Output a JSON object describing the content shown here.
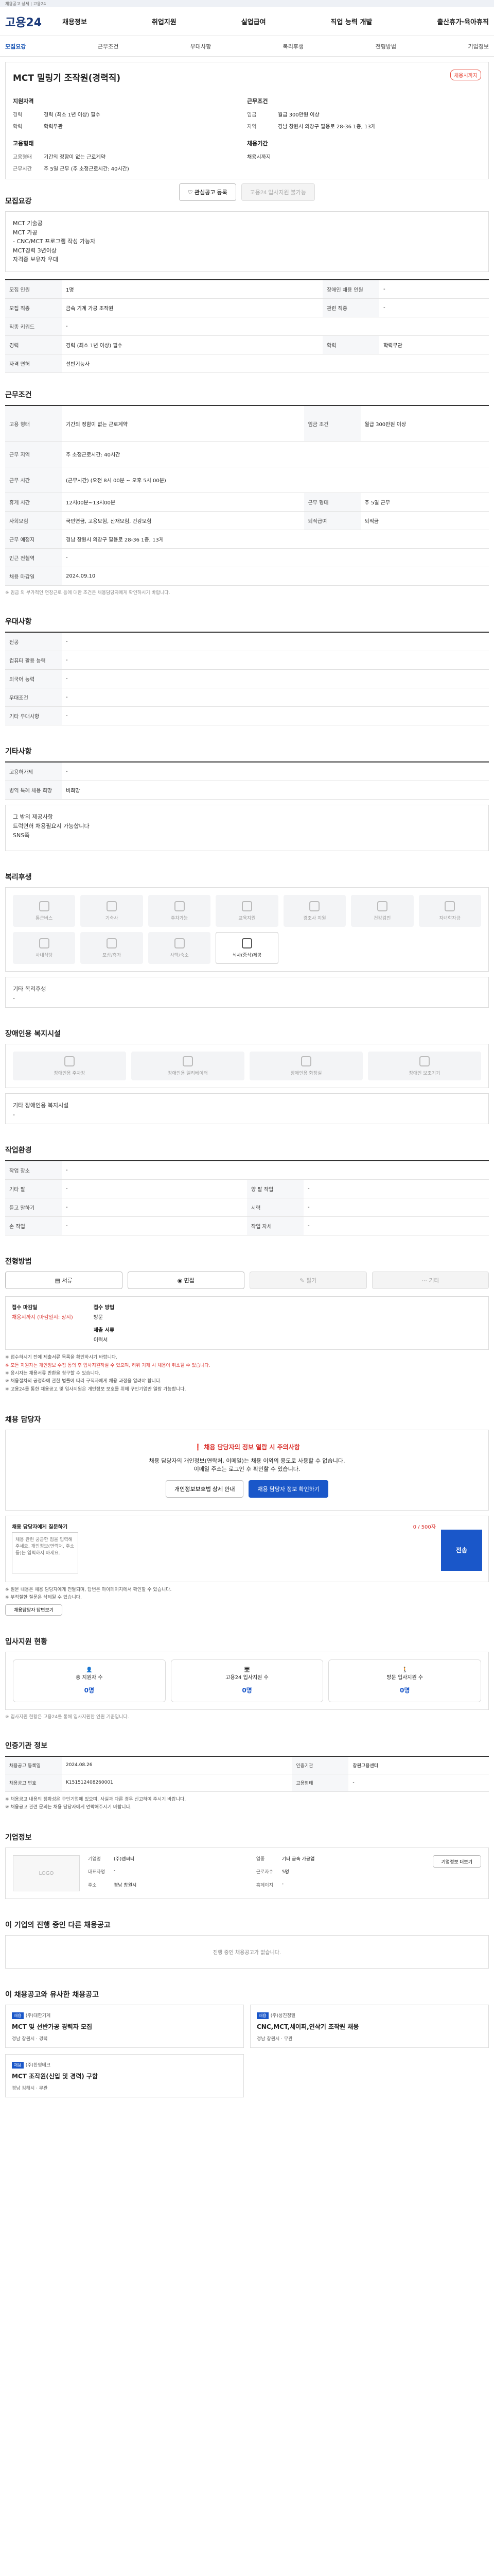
{
  "topbar": "채용공고 상세 | 고용24",
  "gnb": {
    "logo": "고용24",
    "menu": [
      "채용정보",
      "취업지원",
      "실업급여",
      "직업 능력 개발",
      "출산휴가·육아휴직"
    ]
  },
  "tabs": [
    "모집요강",
    "근무조건",
    "우대사항",
    "복리후생",
    "전형방법",
    "기업정보"
  ],
  "header": {
    "title": "MCT 밀링기 조작원(경력직)",
    "dday": "채용시까지",
    "qual_title": "지원자격",
    "cond_title": "근무조건",
    "career_k": "경력",
    "career_v": "경력 (최소 1년 이상) 필수",
    "edu_k": "학력",
    "edu_v": "학력무관",
    "pay_k": "임금",
    "pay_v": "월급 300만원 이상",
    "loc_k": "지역",
    "loc_v": "경남 창원시 의창구 팔용로 28-36 1층, 13게",
    "form_title": "고용형태",
    "form_k": "고용형태",
    "form_v": "기간의 정함이 없는 근로계약",
    "time_k": "근무시간",
    "time_v": "주 5일 근무 (주 소정근로시간: 40시간)",
    "period_title": "채용기간",
    "period_v": "채용시까지",
    "interest_btn": "관심공고 등록",
    "apply_btn": "고용24 입사지원 불가능"
  },
  "recruit": {
    "title": "모집요강",
    "desc_lines": [
      "MCT 기술공",
      "MCT 가공",
      "- CNC/MCT 프로그램 작성 가능자",
      "",
      "MCT경력 3년이상",
      "자격증 보유자 우대"
    ],
    "rows": [
      {
        "k": "모집 인원",
        "v": "1명",
        "k2": "장애인 채용 인원",
        "v2": "-"
      },
      {
        "k": "모집 직종",
        "v": "금속 기계 가공 조작원",
        "k2": "관련 직종",
        "v2": "-"
      },
      {
        "k": "직종 키워드",
        "v": "-",
        "k2": "",
        "v2": ""
      },
      {
        "k": "경력",
        "v": "경력 (최소 1년 이상) 필수",
        "k2": "학력",
        "v2": "학력무관"
      },
      {
        "k": "자격 면허",
        "v": "선반기능사",
        "k2": "",
        "v2": ""
      }
    ]
  },
  "work": {
    "title": "근무조건",
    "rows": [
      {
        "k": "고용 형태",
        "v": "기간의 정함이 없는 근로계약",
        "k2": "임금 조건",
        "v2": "월급 300만원 이상"
      },
      {
        "k": "근무 지역",
        "v": "주 소정근로시간: 40시간",
        "k2": "",
        "v2": ""
      },
      {
        "k": "근무 시간",
        "v": "(근무시간) (오전 8시 00분 ~ 오후 5시 00분)",
        "k2": "",
        "v2": ""
      },
      {
        "k": "휴게 시간",
        "v": "12시00분~13시00분",
        "k2": "근무 형태",
        "v2": "주 5일 근무"
      },
      {
        "k": "사회보험",
        "v": "국민연금, 고용보험, 산재보험, 건강보험",
        "k2": "퇴직급여",
        "v2": "퇴직금"
      },
      {
        "k": "근무 예정지",
        "v": "경남 창원시 의창구 팔용로 28-36 1층, 13게",
        "k2": "",
        "v2": ""
      },
      {
        "k": "인근 전철역",
        "v": "-",
        "k2": "",
        "v2": ""
      },
      {
        "k": "채용 마감일",
        "v": "2024.09.10",
        "k2": "",
        "v2": ""
      }
    ],
    "note": "※ 임금 외 부가적인 연장근로 등에 대한 조건은 채용담당자에게 확인하시기 바랍니다."
  },
  "pref": {
    "title": "우대사항",
    "rows": [
      {
        "k": "전공",
        "v": "-"
      },
      {
        "k": "컴퓨터 활용 능력",
        "v": "-"
      },
      {
        "k": "외국어 능력",
        "v": "-"
      },
      {
        "k": "우대조건",
        "v": "-"
      },
      {
        "k": "기타 우대사항",
        "v": "-"
      }
    ]
  },
  "etc": {
    "title": "기타사항",
    "rows": [
      {
        "k": "고용허가제",
        "v": "-"
      },
      {
        "k": "병역 특례 채용 희망",
        "v": "비희망"
      }
    ],
    "memo_lines": [
      "그 밖의 제공사항",
      "트럭면허 채용필요시 가능합니다",
      "SNS쪽"
    ]
  },
  "welfare": {
    "title": "복리후생",
    "items": [
      "통근버스",
      "기숙사",
      "주차가능",
      "교육지원",
      "경조사 지원",
      "건강검진",
      "자녀학자금",
      "사내식당",
      "포상/휴가",
      "사택/숙소",
      "식사(중식)제공",
      "",
      "",
      ""
    ],
    "extra_title": "기타 복리후생",
    "extra_v": "-"
  },
  "disability": {
    "title": "장애인용 복지시설",
    "items": [
      "장애인용 주차장",
      "장애인용 엘리베이터",
      "장애인용 화장실",
      "장애인 보조기기"
    ],
    "extra_title": "기타 장애인용 복지시설",
    "extra_v": "-"
  },
  "workenv": {
    "title": "작업환경",
    "rows": [
      {
        "k": "작업 장소",
        "v": "-",
        "k2": "",
        "v2": ""
      },
      {
        "k": "기타 팔",
        "v": "-",
        "k2": "양 팔 작업",
        "v2": "-"
      },
      {
        "k": "듣고 말하기",
        "v": "-",
        "k2": "시력",
        "v2": "-"
      },
      {
        "k": "손 작업",
        "v": "-",
        "k2": "작업 자세",
        "v2": "-"
      }
    ]
  },
  "method": {
    "title": "전형방법",
    "buttons": [
      "서류",
      "면접",
      "필기",
      "기타"
    ],
    "apply_label": "접수 마감일",
    "apply_v": "채용시까지 (마감일시: 상시)",
    "apply_label2": "접수 방법",
    "apply_v2": "방문",
    "docs_label": "제출 서류",
    "docs_v": "이력서",
    "bullets": [
      "※ 접수하시기 전에 제출서류 목록을 확인하시기 바랍니다.",
      "※ 모든 지원자는 개인정보 수집 동의 후 입사지원하실 수 있으며, 허위 기재 시 채용이 취소될 수 있습니다.",
      "※ 응시자는 채용서류 반환을 청구할 수 있습니다.",
      "※ 채용절차의 공정화에 관한 법률에 따라 구직자에게 채용 과정을 알려야 합니다.",
      "※ 고용24를 통한 채용공고 및 입사지원은 개인정보 보호를 위해 구인기업만 열람 가능합니다."
    ]
  },
  "manager": {
    "title": "채용 담당자",
    "warn": "채용 담당자의 정보 열람 시 주의사항",
    "desc1": "채용 담당자의 개인정보(연락처, 이메일)는 채용 이외의 용도로 사용할 수 없습니다.",
    "desc2": "이메일 주소는 로그인 후 확인할 수 있습니다.",
    "btn1": "개인정보보호법 상세 안내",
    "btn2": "채용 담당자 정보 확인하기",
    "qa_title": "채용 담당자에게 질문하기",
    "qa_limit": "0 / 500자",
    "qa_placeholder": "채용 관련 궁금한 점을 입력해주세요. 개인정보(연락처, 주소 등)는 입력하지 마세요.",
    "qa_send": "전송",
    "qa_notes": [
      "※ 질문 내용은 채용 담당자에게 전달되며, 답변은 마이페이지에서 확인할 수 있습니다.",
      "※ 부적절한 질문은 삭제될 수 있습니다."
    ],
    "qa_btn": "채용담당자 답변보기"
  },
  "applicants": {
    "title": "입사지원 현황",
    "items": [
      {
        "label": "총 지원자 수",
        "num": "0명"
      },
      {
        "label": "고용24 입사지원 수",
        "num": "0명"
      },
      {
        "label": "방문 입사지원 수",
        "num": "0명"
      }
    ],
    "note": "※ 입사지원 현황은 고용24를 통해 입사지원한 인원 기준입니다."
  },
  "jobinfo": {
    "title": "인증기관 정보",
    "rows": [
      {
        "k": "채용공고 등록일",
        "v": "2024.08.26",
        "k2": "인증기관",
        "v2": "창원고용센터"
      },
      {
        "k": "채용공고 번호",
        "v": "K151512408260001",
        "k2": "고용형태",
        "v2": "-"
      }
    ],
    "bullets": [
      "※ 채용공고 내용의 정확성은 구인기업에 있으며, 사실과 다른 경우 신고하여 주시기 바랍니다.",
      "※ 채용공고 관련 문의는 채용 담당자에게 연락해주시기 바랍니다."
    ]
  },
  "company": {
    "title": "기업정보",
    "logo": "LOGO",
    "fields": [
      {
        "k": "기업명",
        "v": "(주)엠씨티"
      },
      {
        "k": "업종",
        "v": "기타 금속 가공업"
      },
      {
        "k": "대표자명",
        "v": "-"
      },
      {
        "k": "근로자수",
        "v": "5명"
      },
      {
        "k": "주소",
        "v": "경남 창원시"
      },
      {
        "k": "홈페이지",
        "v": "-"
      }
    ],
    "btn": "기업정보 더보기"
  },
  "other": {
    "title": "이 기업의 진행 중인 다른 채용공고",
    "empty": "진행 중인 채용공고가 없습니다."
  },
  "recommend": {
    "title": "이 채용공고와 유사한 채용공고",
    "cards": [
      {
        "tag": "채용",
        "company": "(주)대한기계",
        "title": "MCT 및 선반가공 경력자 모집",
        "meta": "경남 창원시 · 경력"
      },
      {
        "tag": "채용",
        "company": "(주)성진정밀",
        "title": "CNC,MCT,세이퍼,연삭기 조작원 채용",
        "meta": "경남 창원시 · 무관"
      },
      {
        "tag": "채용",
        "company": "(주)한영테크",
        "title": "MCT 조작원(신입 및 경력) 구함",
        "meta": "경남 김해시 · 무관"
      }
    ]
  }
}
